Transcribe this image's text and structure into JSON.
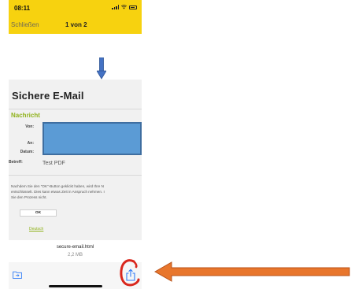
{
  "status_bar": {
    "time": "08:11"
  },
  "nav": {
    "close_label": "Schließen",
    "page_indicator": "1 von 2"
  },
  "preview": {
    "title": "Sichere E-Mail",
    "section_label": "Nachricht",
    "fields": {
      "from_label": "Von:",
      "to_label": "An:",
      "date_label": "Datum:",
      "subject_label": "Betreff:",
      "subject_value": "Test PDF"
    },
    "info_lines": [
      "Nachdem Sie den \"OK\"-Button geklickt haben, wird Ihre N",
      "entschlüsselt. Dies kann etwas Zeit in Anspruch nehmen. I",
      "Sie den Prozess nicht."
    ],
    "ok_label": "OK",
    "language_link": "Deutsch"
  },
  "file": {
    "name": "secure-email.html",
    "size": "2,2 MB"
  },
  "icons": {
    "folder": "folder-icon",
    "share": "share-icon",
    "down_arrow": "down-arrow-annotation",
    "left_arrow": "left-arrow-annotation",
    "circle": "circle-annotation"
  },
  "colors": {
    "topbar": "#f7d20f",
    "accent_green": "#8fb21b",
    "redaction_blue": "#5b9bd5",
    "annotation_orange": "#e8762c",
    "annotation_red": "#d9261c",
    "ios_blue": "#2f7bf6"
  }
}
